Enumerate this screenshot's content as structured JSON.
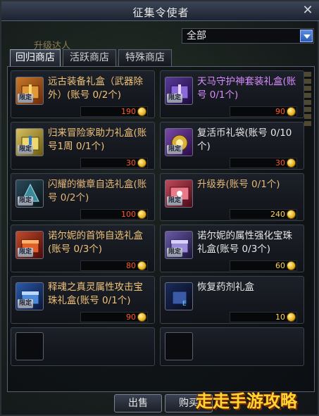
{
  "window": {
    "title": "征集令使者"
  },
  "background": {
    "label": "升级达人"
  },
  "filter": {
    "selected": "全部"
  },
  "tabs": [
    {
      "label": "回归商店",
      "active": true
    },
    {
      "label": "活跃商店",
      "active": false
    },
    {
      "label": "特殊商店",
      "active": false
    }
  ],
  "items": [
    {
      "name": "远古装备礼盒（武器除外）(账号 0/2个)",
      "price": "190",
      "badge": "限定",
      "color": "#f0c27a",
      "icon": "gift-box-icon"
    },
    {
      "name": "天马守护神套装礼盒(账号 0/1个)",
      "price": "90",
      "badge": "限定",
      "color": "#d98cff",
      "icon": "gift-box-icon"
    },
    {
      "name": "归来冒险家助力礼盒(账号1周 0/1个)",
      "price": "30",
      "badge": "限定",
      "color": "#f0c27a",
      "icon": "gift-box-icon"
    },
    {
      "name": "复活币礼袋(账号 0/10个)",
      "price": "30",
      "badge": "限定",
      "color": "#e8e8e8",
      "icon": "coin-bag-icon"
    },
    {
      "name": "闪耀的徽章自选礼盒(账号 0/2个)",
      "price": "100",
      "badge": "限定",
      "color": "#e5b679",
      "icon": "badge-box-icon"
    },
    {
      "name": "升级券(账号 0/1个)",
      "price": "240",
      "badge": "限定",
      "color": "#e5b679",
      "icon": "ticket-icon"
    },
    {
      "name": "诺尔妮的首饰自选礼盒(账号 0/3个)",
      "price": "80",
      "badge": "限定",
      "color": "#f0c27a",
      "icon": "jewelry-box-icon"
    },
    {
      "name": "诺尔妮的属性强化宝珠礼盒(账号 0/3个)",
      "price": "60",
      "badge": "限定",
      "color": "#e8e8e8",
      "icon": "orb-box-icon"
    },
    {
      "name": "释魂之真灵属性攻击宝珠礼盒(账号 0/1个)",
      "price": "90",
      "badge": "限定",
      "color": "#f0c27a",
      "icon": "orb-box-icon"
    },
    {
      "name": "恢复药剂礼盒",
      "price": "10",
      "badge": "",
      "color": "#e8e8e8",
      "icon": "potion-box-icon"
    }
  ],
  "buttons": {
    "sell": "出售",
    "buy": "购买"
  },
  "watermark": "走走手游攻略"
}
